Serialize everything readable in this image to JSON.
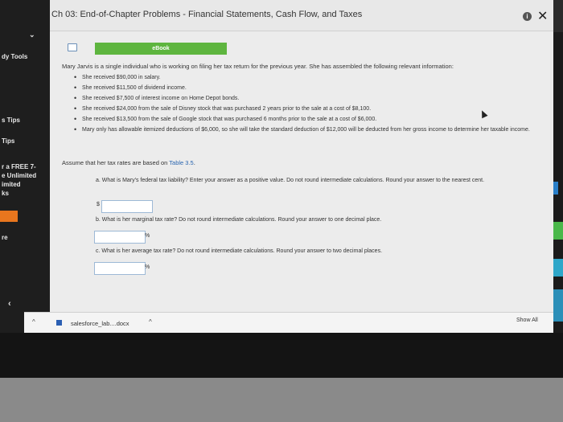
{
  "window": {
    "title": "Ch 03: End-of-Chapter Problems - Financial Statements, Cash Flow, and Taxes",
    "info_icon_label": "i",
    "close_label": "✕"
  },
  "sidebar": {
    "tools_label": "dy Tools",
    "tips_1": "s Tips",
    "tips_2": "Tips",
    "promo_1": "r a FREE 7-",
    "promo_2": "e Unlimited",
    "promo_3": "imited",
    "promo_4": "ks",
    "orange_label": "re",
    "re_label": "re"
  },
  "problem": {
    "ebook_label": "eBook",
    "intro": "Mary Jarvis is a single individual who is working on filing her tax return for the previous year. She has assembled the following relevant information:",
    "facts": [
      "She received $90,000 in salary.",
      "She received $11,500 of dividend income.",
      "She received $7,500 of interest income on Home Depot bonds.",
      "She received $24,000 from the sale of Disney stock that was purchased 2 years prior to the sale at a cost of $8,100.",
      "She received $13,500 from the sale of Google stock that was purchased 6 months prior to the sale at a cost of $6,000.",
      "Mary only has allowable itemized deductions of $6,000, so she will take the standard deduction of $12,000 will be deducted from her gross income to determine her taxable income."
    ],
    "assume_prefix": "Assume that her tax rates are based on ",
    "assume_link": "Table 3.5",
    "assume_suffix": ".",
    "question_a": "a. What is Mary's federal tax liability? Enter your answer as a positive value. Do not round intermediate calculations. Round your answer to the nearest cent.",
    "unit_a": "$",
    "question_b": "b. What is her marginal tax rate? Do not round intermediate calculations. Round your answer to one decimal place.",
    "unit_b": "%",
    "question_c": "c. What is her average tax rate? Do not round intermediate calculations. Round your answer to two decimal places.",
    "unit_c": "%",
    "answer_a": "",
    "answer_b": "",
    "answer_c": ""
  },
  "downloads": {
    "file_name": "salesforce_lab....docx",
    "show_all": "Show All"
  }
}
